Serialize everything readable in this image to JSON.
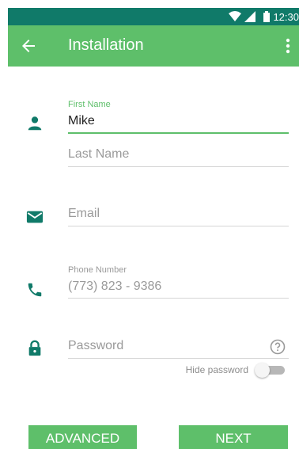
{
  "status_bar": {
    "time": "12:30",
    "color": "#107a69"
  },
  "app_bar": {
    "title": "Installation",
    "color": "#5ebf6a",
    "icons": {
      "back": "arrow-back-icon",
      "overflow": "more-vert-icon"
    }
  },
  "form": {
    "first_name": {
      "label": "First Name",
      "value": "Mike",
      "icon": "person-icon"
    },
    "last_name": {
      "placeholder": "Last Name"
    },
    "email": {
      "placeholder": "Email",
      "icon": "email-icon"
    },
    "phone": {
      "label": "Phone Number",
      "placeholder": "(773) 823 - 9386",
      "icon": "phone-icon"
    },
    "password": {
      "placeholder": "Password",
      "icon": "lock-icon",
      "help_icon": "help-circle-icon"
    },
    "hide_password": {
      "label": "Hide password",
      "checked": false
    }
  },
  "actions": {
    "advanced_label": "ADVANCED",
    "next_label": "NEXT"
  },
  "colors": {
    "accent": "#5ebf6a",
    "icon_dark": "#107a69"
  }
}
